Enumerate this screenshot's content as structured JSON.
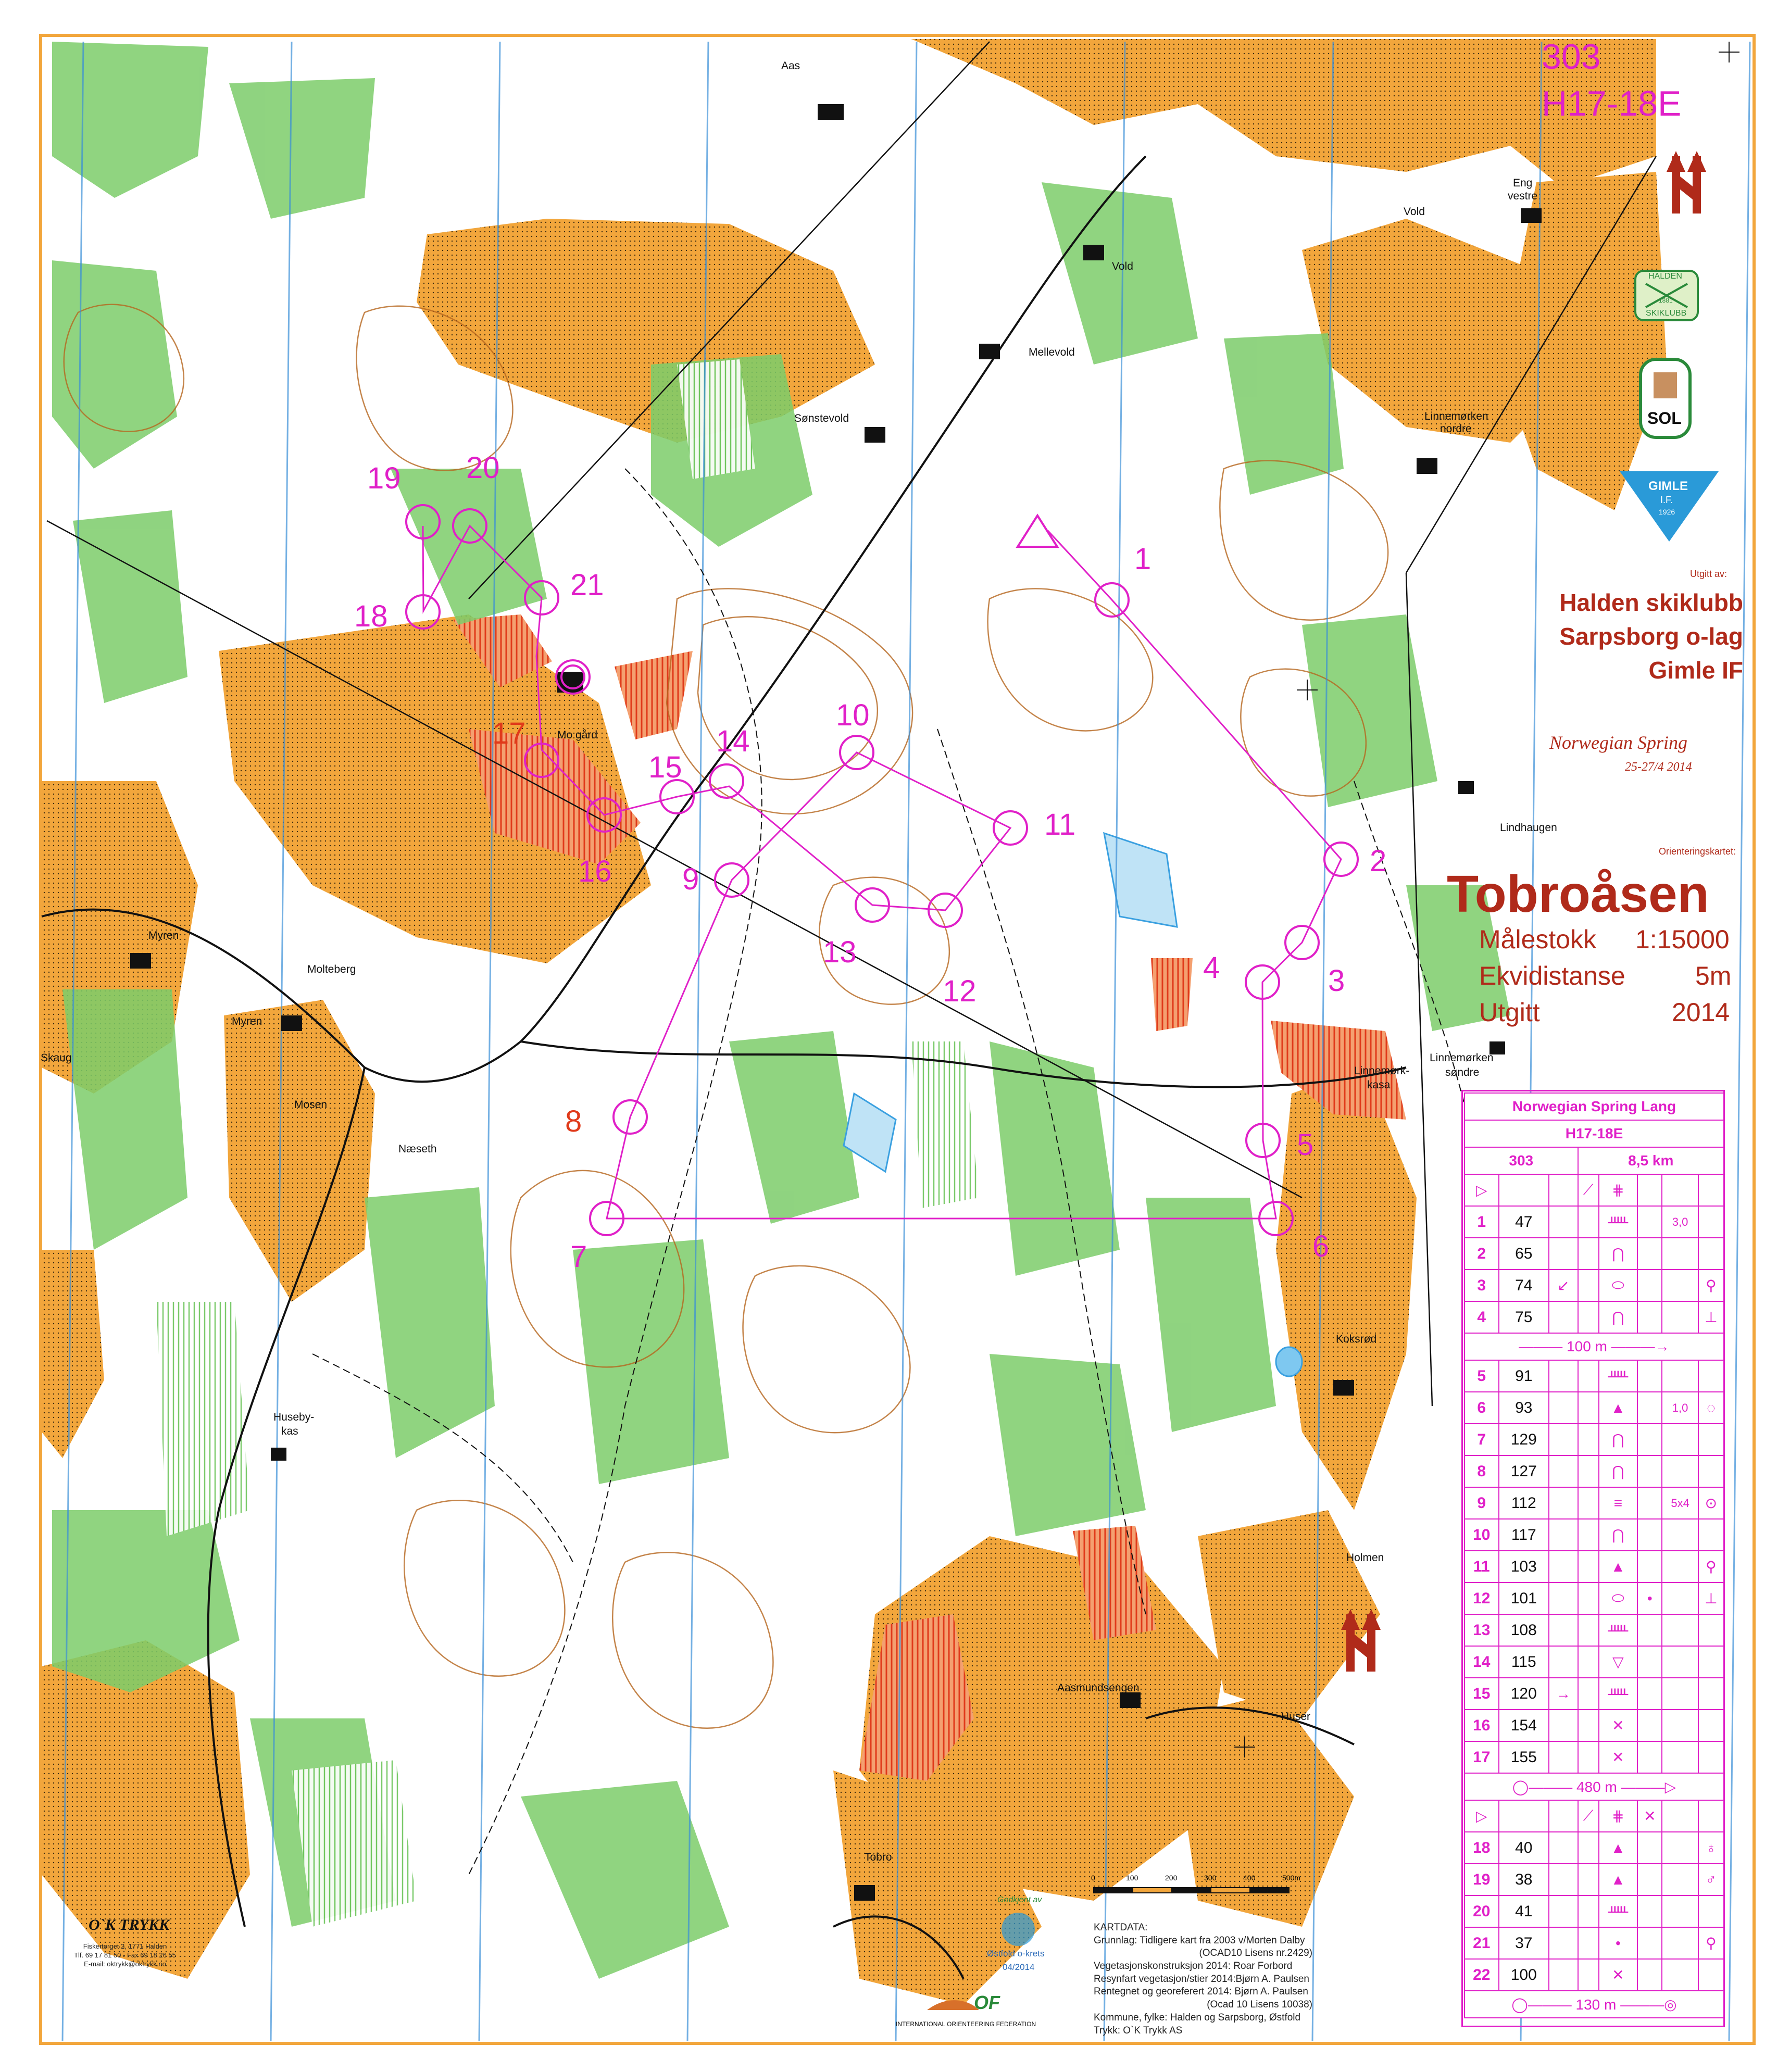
{
  "course": {
    "number": "303",
    "class": "H17-18E"
  },
  "clubs": {
    "published_by_label": "Utgitt av:",
    "club1": "Halden skiklubb",
    "club2": "Sarpsborg o-lag",
    "club3": "Gimle IF"
  },
  "logos": {
    "halden_top": "HALDEN",
    "halden_year": "1881",
    "halden_bottom": "SKIKLUBB",
    "sol": "SOL",
    "gimle": "GIMLE",
    "gimle_if": "I.F.",
    "gimle_year": "1926"
  },
  "event": {
    "name": "Norwegian Spring",
    "dates": "25-27/4 2014"
  },
  "map_info": {
    "map_label": "Orienteringskartet:",
    "map_name": "Tobroåsen",
    "scale_label": "Målestokk",
    "scale_value": "1:15000",
    "contour_label": "Ekvidistanse",
    "contour_value": "5m",
    "issued_label": "Utgitt",
    "issued_value": "2014"
  },
  "places": {
    "aas": "Aas",
    "vold1": "Vold",
    "vold2": "Vold",
    "eng": "Eng",
    "eng2": "vestre",
    "mellevold": "Mellevold",
    "sonstevold": "Sønstevold",
    "linnemorken": "Linnemørken",
    "linnemorken2": "nordre",
    "mo_gard": "Mo gård",
    "lindhaugen": "Lindhaugen",
    "myren1": "Myren",
    "myren2": "Myren",
    "molteberg": "Molteberg",
    "skaug": "Skaug",
    "mosen": "Mosen",
    "naeseth": "Næseth",
    "ls1": "Linnemørken",
    "ls2": "søndre",
    "lk1": "Linnemørk-",
    "lk2": "kasa",
    "koksrod": "Koksrød",
    "huseby1": "Huseby-",
    "huseby2": "kas",
    "holmen": "Holmen",
    "aasmundsengen": "Aasmundsengen",
    "huser": "Huser",
    "tobro": "Tobro"
  },
  "controls": [
    {
      "id": "1",
      "label": "1"
    },
    {
      "id": "2",
      "label": "2"
    },
    {
      "id": "3",
      "label": "3"
    },
    {
      "id": "4",
      "label": "4"
    },
    {
      "id": "5",
      "label": "5"
    },
    {
      "id": "6",
      "label": "6"
    },
    {
      "id": "7",
      "label": "7"
    },
    {
      "id": "8",
      "label": "8"
    },
    {
      "id": "9",
      "label": "9"
    },
    {
      "id": "10",
      "label": "10"
    },
    {
      "id": "11",
      "label": "11"
    },
    {
      "id": "12",
      "label": "12"
    },
    {
      "id": "13",
      "label": "13"
    },
    {
      "id": "14",
      "label": "14"
    },
    {
      "id": "15",
      "label": "15"
    },
    {
      "id": "16",
      "label": "16"
    },
    {
      "id": "17",
      "label": "17"
    },
    {
      "id": "18",
      "label": "18"
    },
    {
      "id": "19",
      "label": "19"
    },
    {
      "id": "20",
      "label": "20"
    },
    {
      "id": "21",
      "label": "21"
    }
  ],
  "control_descriptions": {
    "title": "Norwegian Spring Lang",
    "class": "H17-18E",
    "course_number": "303",
    "length": "8,5 km",
    "rows1": [
      {
        "n": "1",
        "code": "47",
        "c": "",
        "d": "",
        "e": "ᚊ",
        "f": "",
        "g": "3,0",
        "h": ""
      },
      {
        "n": "2",
        "code": "65",
        "c": "",
        "d": "",
        "e": "⋂",
        "f": "",
        "g": "",
        "h": ""
      },
      {
        "n": "3",
        "code": "74",
        "c": "↙",
        "d": "",
        "e": "⬭",
        "f": "",
        "g": "",
        "h": "⚲"
      },
      {
        "n": "4",
        "code": "75",
        "c": "",
        "d": "",
        "e": "⋂",
        "f": "",
        "g": "",
        "h": "⊥"
      }
    ],
    "leg1": "100 m",
    "rows2": [
      {
        "n": "5",
        "code": "91",
        "c": "",
        "d": "",
        "e": "ᚊ",
        "f": "",
        "g": "",
        "h": ""
      },
      {
        "n": "6",
        "code": "93",
        "c": "",
        "d": "",
        "e": "▲",
        "f": "",
        "g": "1,0",
        "h": "◌"
      },
      {
        "n": "7",
        "code": "129",
        "c": "",
        "d": "",
        "e": "⋂",
        "f": "",
        "g": "",
        "h": ""
      },
      {
        "n": "8",
        "code": "127",
        "c": "",
        "d": "",
        "e": "⋂",
        "f": "",
        "g": "",
        "h": ""
      },
      {
        "n": "9",
        "code": "112",
        "c": "",
        "d": "",
        "e": "≡",
        "f": "",
        "g": "5x4",
        "h": "⊙"
      },
      {
        "n": "10",
        "code": "117",
        "c": "",
        "d": "",
        "e": "⋂",
        "f": "",
        "g": "",
        "h": ""
      },
      {
        "n": "11",
        "code": "103",
        "c": "",
        "d": "",
        "e": "▲",
        "f": "",
        "g": "",
        "h": "⚲"
      },
      {
        "n": "12",
        "code": "101",
        "c": "",
        "d": "",
        "e": "⬭",
        "f": "•",
        "g": "",
        "h": "⊥"
      },
      {
        "n": "13",
        "code": "108",
        "c": "",
        "d": "",
        "e": "ᚊ",
        "f": "",
        "g": "",
        "h": ""
      },
      {
        "n": "14",
        "code": "115",
        "c": "",
        "d": "",
        "e": "▽",
        "f": "",
        "g": "",
        "h": ""
      },
      {
        "n": "15",
        "code": "120",
        "c": "→",
        "d": "",
        "e": "ᚊ",
        "f": "",
        "g": "",
        "h": ""
      },
      {
        "n": "16",
        "code": "154",
        "c": "",
        "d": "",
        "e": "✕",
        "f": "",
        "g": "",
        "h": ""
      },
      {
        "n": "17",
        "code": "155",
        "c": "",
        "d": "",
        "e": "✕",
        "f": "",
        "g": "",
        "h": ""
      }
    ],
    "leg2": "480 m",
    "rows3": [
      {
        "n": "18",
        "code": "40",
        "c": "",
        "d": "",
        "e": "▲",
        "f": "",
        "g": "",
        "h": "♁"
      },
      {
        "n": "19",
        "code": "38",
        "c": "",
        "d": "",
        "e": "▲",
        "f": "",
        "g": "",
        "h": "♂"
      },
      {
        "n": "20",
        "code": "41",
        "c": "",
        "d": "",
        "e": "ᚊ",
        "f": "",
        "g": "",
        "h": ""
      },
      {
        "n": "21",
        "code": "37",
        "c": "",
        "d": "",
        "e": "•",
        "f": "",
        "g": "",
        "h": "⚲"
      },
      {
        "n": "22",
        "code": "100",
        "c": "",
        "d": "",
        "e": "✕",
        "f": "",
        "g": "",
        "h": ""
      }
    ],
    "leg3": "130 m"
  },
  "scale_bar": {
    "ticks": [
      "0",
      "100",
      "200",
      "300",
      "400",
      "500m"
    ]
  },
  "credits": {
    "title": "KARTDATA:",
    "lines": [
      "Grunnlag: Tidligere kart fra 2003 v/Morten Dalby",
      "(OCAD10 Lisens nr.2429)",
      "Vegetasjonskonstruksjon 2014:   Roar Forbord",
      "Resynfart vegetasjon/stier 2014:Bjørn A. Paulsen",
      "Rentegnet og georeferert 2014: Bjørn A. Paulsen",
      "(Ocad 10 Lisens 10038)",
      "Kommune, fylke:   Halden og Sarpsborg, Østfold",
      "Trykk:                                O`K Trykk AS"
    ]
  },
  "printer": {
    "logo": "O`K TRYKK",
    "address": "Fiskertorget 2, 1771 Halden",
    "phone": "Tlf. 69 17 81 50 - Fax 69 18 26 55",
    "email": "E-mail: oktrykk@oktrykk.no"
  },
  "approval": {
    "text": "Godkjent av",
    "krets": "Østfold o-krets",
    "date": "04/2014"
  },
  "federation": {
    "logo": "OF",
    "name": "INTERNATIONAL ORIENTEERING FEDERATION"
  },
  "colors": {
    "course": "#e020c8",
    "open_land": "#f2a63c",
    "forest": "#ffffff",
    "green": "#7ccc6a",
    "contour": "#b5651d",
    "water": "#3aa0e0",
    "magnetic_north": "#3a8fd8",
    "brown_text": "#b02a1a"
  }
}
